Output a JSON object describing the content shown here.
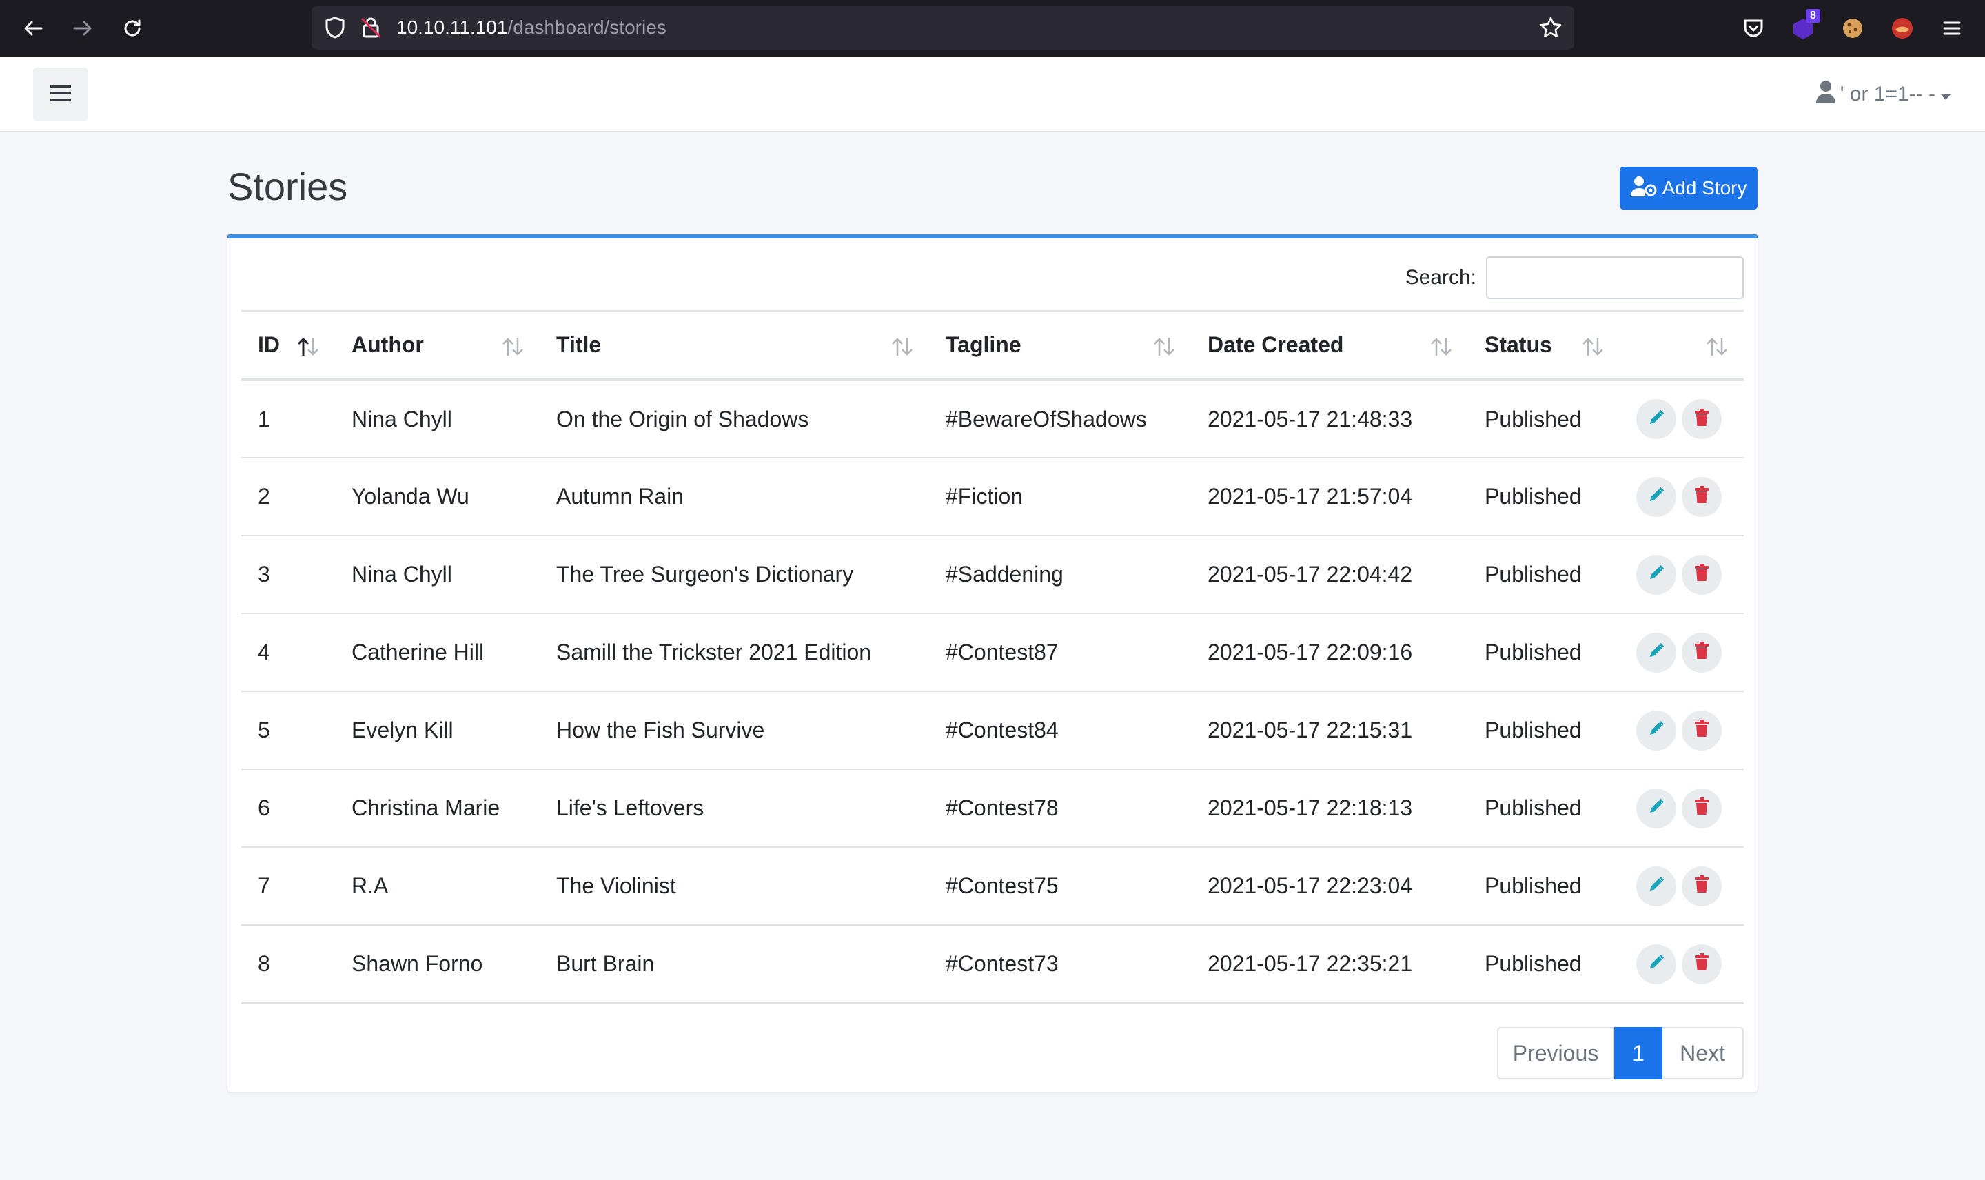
{
  "browser": {
    "url_host": "10.10.11.101",
    "url_path": "/dashboard/stories",
    "extension_badge": "8"
  },
  "navbar": {
    "user_label": "' or 1=1-- -"
  },
  "page": {
    "title": "Stories",
    "add_button_label": "Add Story"
  },
  "table": {
    "search_label": "Search:",
    "search_value": "",
    "columns": [
      "ID",
      "Author",
      "Title",
      "Tagline",
      "Date Created",
      "Status",
      ""
    ],
    "rows": [
      {
        "id": "1",
        "author": "Nina Chyll",
        "title": "On the Origin of Shadows",
        "tagline": "#BewareOfShadows",
        "date": "2021-05-17 21:48:33",
        "status": "Published"
      },
      {
        "id": "2",
        "author": "Yolanda Wu",
        "title": "Autumn Rain",
        "tagline": "#Fiction",
        "date": "2021-05-17 21:57:04",
        "status": "Published"
      },
      {
        "id": "3",
        "author": "Nina Chyll",
        "title": "The Tree Surgeon's Dictionary",
        "tagline": "#Saddening",
        "date": "2021-05-17 22:04:42",
        "status": "Published"
      },
      {
        "id": "4",
        "author": "Catherine Hill",
        "title": "Samill the Trickster 2021 Edition",
        "tagline": "#Contest87",
        "date": "2021-05-17 22:09:16",
        "status": "Published"
      },
      {
        "id": "5",
        "author": "Evelyn Kill",
        "title": "How the Fish Survive",
        "tagline": "#Contest84",
        "date": "2021-05-17 22:15:31",
        "status": "Published"
      },
      {
        "id": "6",
        "author": "Christina Marie",
        "title": "Life's Leftovers",
        "tagline": "#Contest78",
        "date": "2021-05-17 22:18:13",
        "status": "Published"
      },
      {
        "id": "7",
        "author": "R.A",
        "title": "The Violinist",
        "tagline": "#Contest75",
        "date": "2021-05-17 22:23:04",
        "status": "Published"
      },
      {
        "id": "8",
        "author": "Shawn Forno",
        "title": "Burt Brain",
        "tagline": "#Contest73",
        "date": "2021-05-17 22:35:21",
        "status": "Published"
      }
    ]
  },
  "pagination": {
    "previous": "Previous",
    "current": "1",
    "next": "Next"
  },
  "colors": {
    "primary": "#1a73e8",
    "card_border": "#3d8fe4",
    "edit_icon": "#17a2b8",
    "delete_icon": "#dc3545"
  }
}
